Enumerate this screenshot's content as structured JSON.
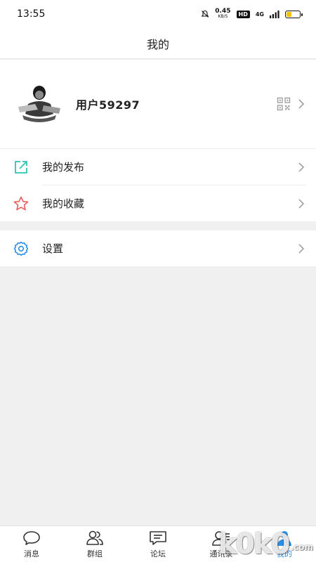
{
  "status_bar": {
    "time": "13:55",
    "speed_value": "0.45",
    "speed_unit": "KB/S",
    "hd": "HD",
    "network": "4G",
    "battery_level": 0.4,
    "battery_color": "#f2c200"
  },
  "header": {
    "title": "我的"
  },
  "profile": {
    "username": "用户59297",
    "qr_icon": "qrcode-icon",
    "chevron_icon": "chevron-right-icon"
  },
  "menu": {
    "items": [
      {
        "label": "我的发布",
        "icon": "share-external-icon",
        "icon_color": "#2ec4b6"
      },
      {
        "label": "我的收藏",
        "icon": "star-icon",
        "icon_color": "#ef5b5b"
      }
    ],
    "settings": {
      "label": "设置",
      "icon": "gear-icon",
      "icon_color": "#2a8fe6"
    }
  },
  "bottom_nav": {
    "items": [
      {
        "label": "消息",
        "icon": "chat-bubble-icon"
      },
      {
        "label": "群组",
        "icon": "group-icon"
      },
      {
        "label": "论坛",
        "icon": "forum-icon"
      },
      {
        "label": "通讯录",
        "icon": "contacts-icon"
      },
      {
        "label": "我的",
        "icon": "profile-icon",
        "active": true
      }
    ],
    "active_color": "#2a8fe6"
  },
  "watermark": {
    "text": "k0k0",
    "suffix": ".com"
  }
}
